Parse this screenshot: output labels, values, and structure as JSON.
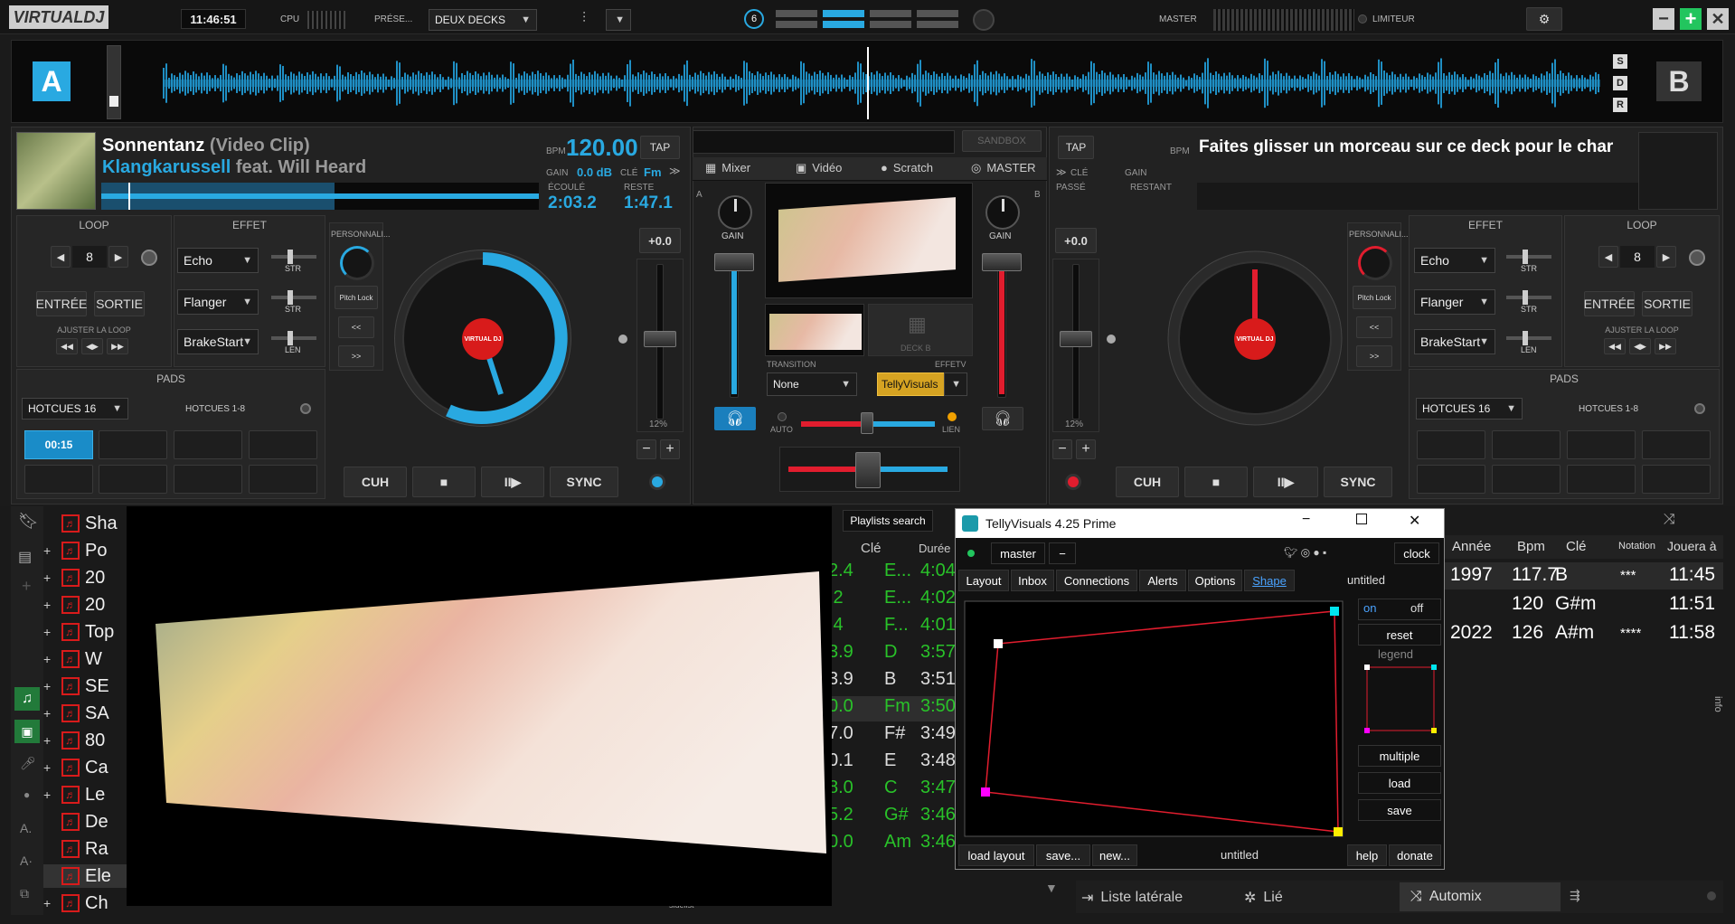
{
  "topbar": {
    "logo": "VIRTUALDJ",
    "clock": "11:46:51",
    "cpu_label": "CPU",
    "preset_label": "PRÉSE...",
    "layout_select": "DEUX DECKS",
    "fx_count": "6",
    "master_label": "MASTER",
    "limiter_label": "LIMITEUR"
  },
  "waveform": {
    "deck_a": "A",
    "deck_b": "B",
    "side_btns": [
      "S",
      "D",
      "R"
    ]
  },
  "deckA": {
    "title": "Sonnentanz",
    "title_suffix": "(Video Clip)",
    "artist": "Klangkarussell",
    "artist_suffix": "feat. Will Heard",
    "bpm_label": "BPM",
    "bpm": "120.00",
    "tap": "TAP",
    "gain_label": "GAIN",
    "gain": "0.0 dB",
    "key_label": "CLÉ",
    "key": "Fm",
    "elapsed_label": "ÉCOULÉ",
    "elapsed": "2:03.2",
    "remain_label": "RESTE",
    "remain": "1:47.1",
    "loop_header": "LOOP",
    "loop_value": "8",
    "in_btn": "ENTRÉE",
    "out_btn": "SORTIE",
    "adjust_loop": "AJUSTER LA LOOP",
    "effect_header": "EFFET",
    "effects": [
      {
        "name": "Echo",
        "knob": "STR"
      },
      {
        "name": "Flanger",
        "knob": "STR"
      },
      {
        "name": "BrakeStart",
        "knob": "LEN"
      }
    ],
    "pads_header": "PADS",
    "pads_mode": "HOTCUES 16",
    "pads_page": "HOTCUES 1-8",
    "pad1": "00:15",
    "custom_label": "PERSONNALI...",
    "pitch_lock": "Pitch Lock",
    "back": "<<",
    "fwd": ">>",
    "pitch": "+0.0",
    "pitch_range": "12%",
    "cue": "CUH",
    "stop": "■",
    "play": "II▶",
    "sync": "SYNC",
    "jog_logo": "VIRTUAL DJ"
  },
  "deckB": {
    "tap": "TAP",
    "bpm_label": "BPM",
    "key_label": "CLÉ",
    "gain_label": "GAIN",
    "elapsed_label": "PASSÉ",
    "remain_label": "RESTANT",
    "empty_msg": "Faites glisser un morceau sur ce deck pour le char",
    "loop_header": "LOOP",
    "loop_value": "8",
    "in_btn": "ENTRÉE",
    "out_btn": "SORTIE",
    "adjust_loop": "AJUSTER LA LOOP",
    "effect_header": "EFFET",
    "effects": [
      {
        "name": "Echo",
        "knob": "STR"
      },
      {
        "name": "Flanger",
        "knob": "STR"
      },
      {
        "name": "BrakeStart",
        "knob": "LEN"
      }
    ],
    "pads_header": "PADS",
    "pads_mode": "HOTCUES 16",
    "pads_page": "HOTCUES 1-8",
    "custom_label": "PERSONNALI...",
    "pitch_lock": "Pitch Lock",
    "back": "<<",
    "fwd": ">>",
    "pitch": "+0.0",
    "pitch_range": "12%",
    "cue": "CUH",
    "stop": "■",
    "play": "II▶",
    "sync": "SYNC",
    "jog_logo": "VIRTUAL DJ"
  },
  "mixer": {
    "sandbox": "SANDBOX",
    "tabs": [
      "Mixer",
      "Vidéo",
      "Scratch",
      "MASTER"
    ],
    "gain": "GAIN",
    "deck_b_label": "DECK B",
    "transition_label": "TRANSITION",
    "transition": "None",
    "effect_label": "EFFETV",
    "effect": "TellyVisuals",
    "auto": "AUTO",
    "link": "LIEN",
    "side_a": "A",
    "side_b": "B"
  },
  "browser": {
    "playlists_search": "Playlists search",
    "col_key": "Clé",
    "col_duration": "Durée",
    "sidelist": "sidelist",
    "folders": [
      "Sha",
      "Po",
      "20",
      "20",
      "Top",
      "W",
      "SE",
      "SA",
      "80",
      "Ca",
      "Le",
      "De",
      "Ra",
      "Ele",
      "Ch"
    ],
    "rows": [
      {
        "n": "2.4",
        "key": "E...",
        "dur": "4:04"
      },
      {
        "n": ".2",
        "key": "E...",
        "dur": "4:02"
      },
      {
        "n": ".4",
        "key": "F...",
        "dur": "4:01"
      },
      {
        "n": "3.9",
        "key": "D",
        "dur": "3:57"
      },
      {
        "n": "3.9",
        "key": "B",
        "dur": "3:51"
      },
      {
        "n": "0.0",
        "key": "Fm",
        "dur": "3:50"
      },
      {
        "n": "7.0",
        "key": "F#",
        "dur": "3:49"
      },
      {
        "n": "0.1",
        "key": "E",
        "dur": "3:48"
      },
      {
        "n": "8.0",
        "key": "C",
        "dur": "3:47"
      },
      {
        "n": "5.2",
        "key": "G#",
        "dur": "3:46"
      },
      {
        "n": "0.0",
        "key": "Am",
        "dur": "3:46 2009"
      }
    ],
    "right_cols": [
      "Année",
      "Bpm",
      "Clé",
      "Notation",
      "Jouera à"
    ],
    "right_rows": [
      {
        "year": "1997",
        "bpm": "117.7",
        "key": "B",
        "rating": "***",
        "time": "11:45"
      },
      {
        "year": "",
        "bpm": "120",
        "key": "G#m",
        "rating": "",
        "time": "11:51"
      },
      {
        "year": "2022",
        "bpm": "126",
        "key": "A#m",
        "rating": "****",
        "time": "11:58"
      }
    ],
    "bottom_tabs": [
      "Liste latérale",
      "Lié",
      "Automix"
    ],
    "info": "info"
  },
  "telly": {
    "title": "TellyVisuals 4.25 Prime",
    "master": "master",
    "minus": "−",
    "clock": "clock",
    "tabs": [
      "Layout",
      "Inbox",
      "Connections",
      "Alerts",
      "Options",
      "Shape"
    ],
    "layout_name": "untitled",
    "on": "on",
    "off": "off",
    "reset": "reset",
    "legend": "legend",
    "multiple": "multiple",
    "load": "load",
    "save": "save",
    "bottom": [
      "load layout",
      "save...",
      "new...",
      "untitled",
      "help",
      "donate"
    ]
  }
}
